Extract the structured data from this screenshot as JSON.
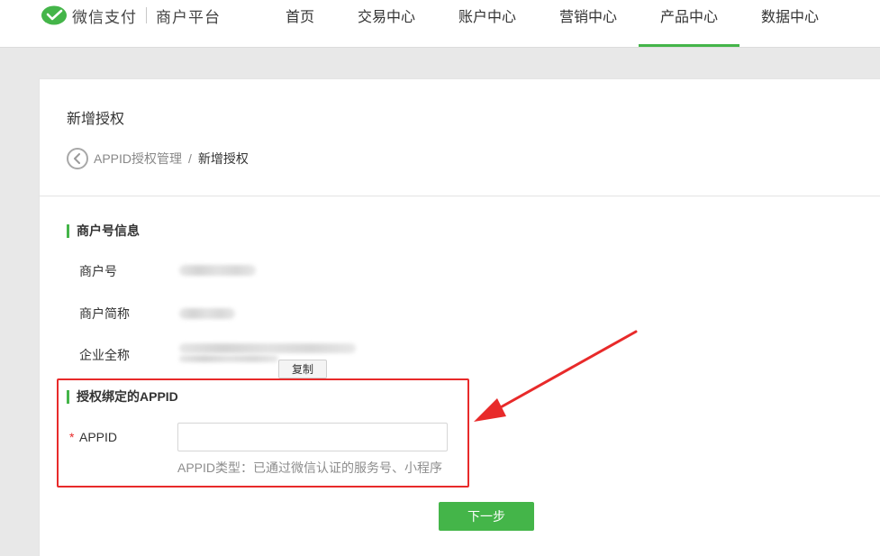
{
  "header": {
    "brand_name": "微信支付",
    "brand_sub": "商户平台",
    "nav": [
      {
        "label": "首页",
        "active": false
      },
      {
        "label": "交易中心",
        "active": false
      },
      {
        "label": "账户中心",
        "active": false
      },
      {
        "label": "营销中心",
        "active": false
      },
      {
        "label": "产品中心",
        "active": true
      },
      {
        "label": "数据中心",
        "active": false
      }
    ]
  },
  "page": {
    "title": "新增授权",
    "breadcrumb": {
      "back_icon": "chevron-left-circle-icon",
      "parent": "APPID授权管理",
      "separator": "/",
      "current": "新增授权"
    }
  },
  "merchant_section": {
    "title": "商户号信息",
    "fields": {
      "merchant_id_label": "商户号",
      "short_name_label": "商户简称",
      "full_name_label": "企业全称"
    },
    "copy_label": "复制"
  },
  "appid_section": {
    "title": "授权绑定的APPID",
    "required_mark": "*",
    "appid_label": "APPID",
    "appid_value": "",
    "appid_placeholder": "",
    "hint": "APPID类型：已通过微信认证的服务号、小程序"
  },
  "actions": {
    "next_label": "下一步"
  },
  "colors": {
    "accent": "#44b549",
    "annotation": "#e82a2a"
  }
}
